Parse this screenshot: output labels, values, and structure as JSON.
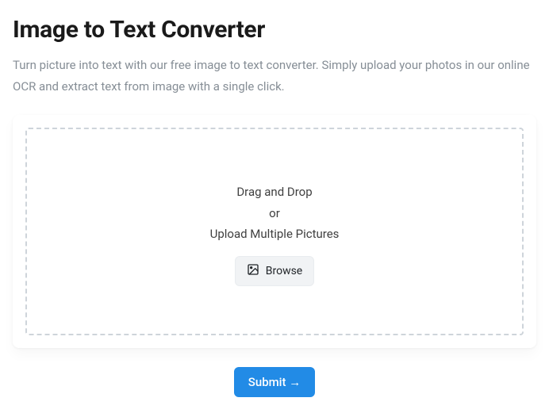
{
  "header": {
    "title": "Image to Text Converter",
    "subtitle": "Turn picture into text with our free image to text converter. Simply upload your photos in our online OCR and extract text from image with a single click."
  },
  "dropzone": {
    "line1": "Drag and Drop",
    "line2": "or",
    "line3": "Upload Multiple Pictures",
    "browse_label": "Browse"
  },
  "actions": {
    "submit_label": "Submit →"
  }
}
